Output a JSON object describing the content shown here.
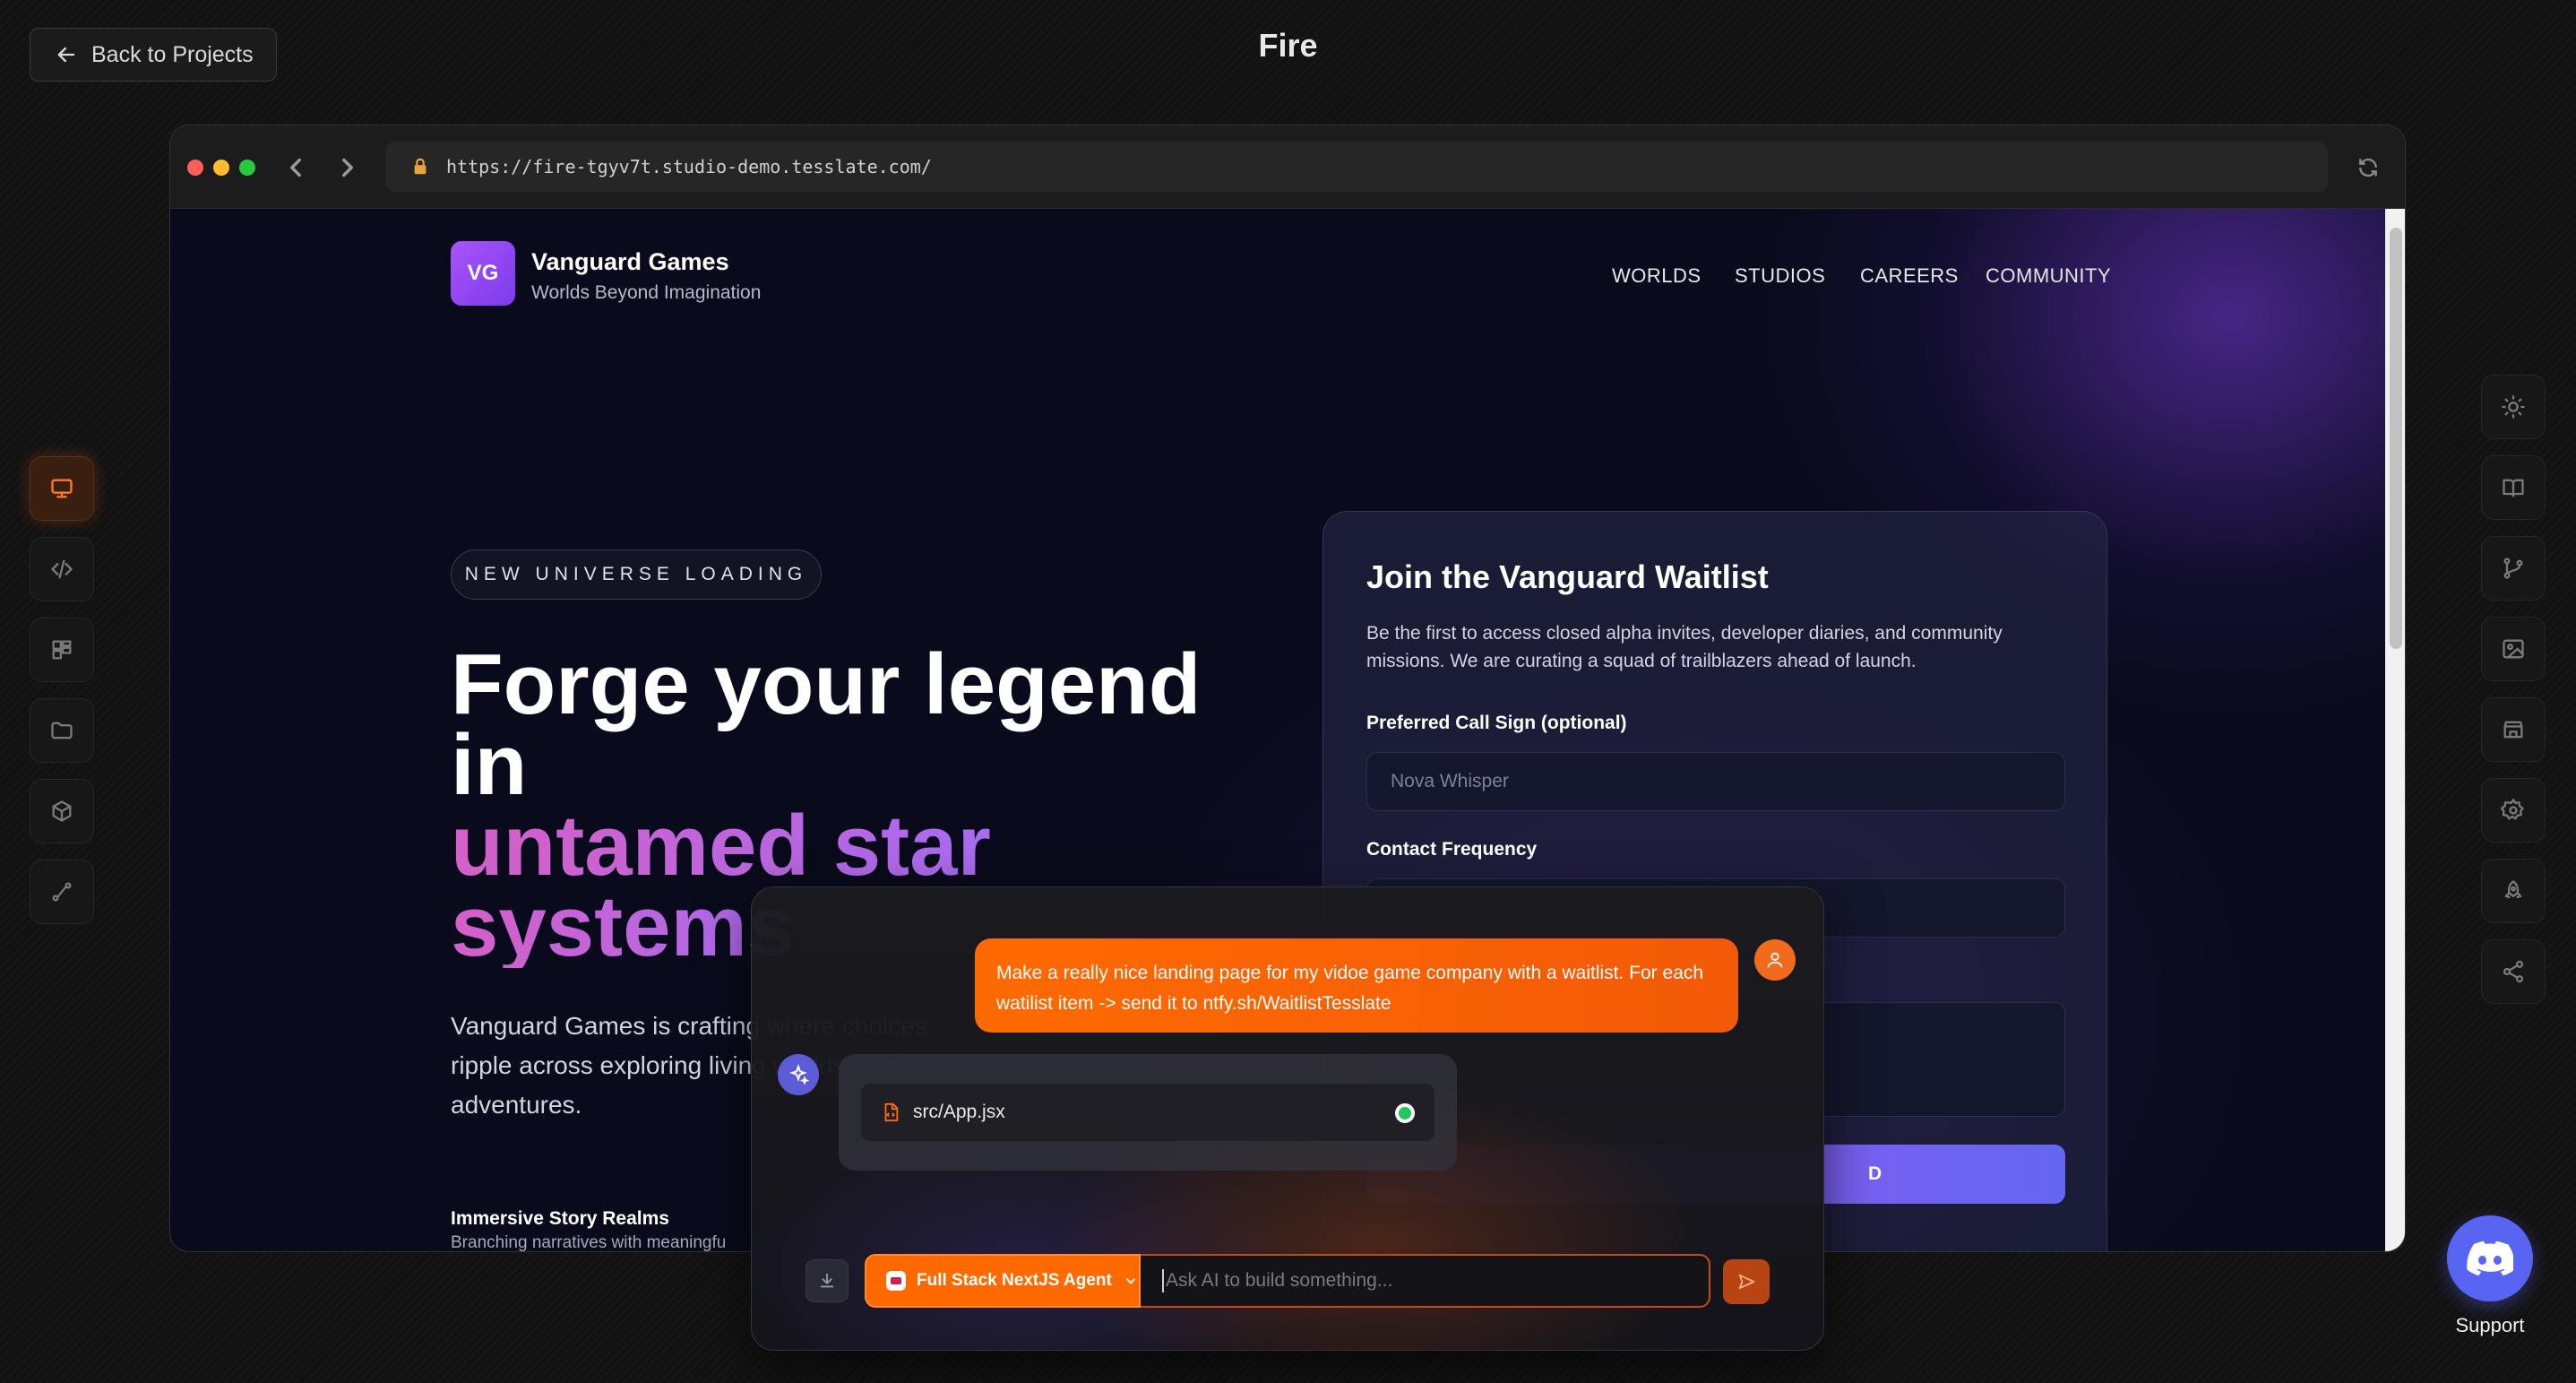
{
  "app": {
    "title": "Fire",
    "back_label": "Back to Projects"
  },
  "left_rail": [
    {
      "name": "preview",
      "icon": "monitor-icon",
      "active": true
    },
    {
      "name": "code",
      "icon": "code-icon",
      "active": false
    },
    {
      "name": "kanban",
      "icon": "kanban-icon",
      "active": false
    },
    {
      "name": "files",
      "icon": "folder-icon",
      "active": false
    },
    {
      "name": "assets",
      "icon": "box-icon",
      "active": false
    },
    {
      "name": "flow",
      "icon": "route-icon",
      "active": false
    }
  ],
  "right_rail": [
    {
      "name": "theme",
      "icon": "sun-icon"
    },
    {
      "name": "docs",
      "icon": "book-icon"
    },
    {
      "name": "git",
      "icon": "git-branch-icon"
    },
    {
      "name": "images",
      "icon": "image-icon"
    },
    {
      "name": "marketplace",
      "icon": "store-icon"
    },
    {
      "name": "settings",
      "icon": "gear-icon"
    },
    {
      "name": "deploy",
      "icon": "rocket-icon"
    },
    {
      "name": "share",
      "icon": "share-icon"
    }
  ],
  "browser": {
    "url": "https://fire-tgyv7t.studio-demo.tesslate.com/"
  },
  "site": {
    "logo_initials": "VG",
    "brand_name": "Vanguard Games",
    "brand_tagline": "Worlds Beyond Imagination",
    "nav": [
      "WORLDS",
      "STUDIOS",
      "CAREERS",
      "COMMUNITY"
    ],
    "pill": "NEW UNIVERSE LOADING",
    "hero_line1": "Forge your legend",
    "hero_line2": "in",
    "hero_line3": "untamed star",
    "hero_line4": "systems",
    "hero_paragraph": "Vanguard Games is crafting where choices ripple across exploring living worlds, evol adventures.",
    "feature_title": "Immersive Story Realms",
    "feature_sub": "Branching narratives with meaningfu"
  },
  "waitlist": {
    "title": "Join the Vanguard Waitlist",
    "description": "Be the first to access closed alpha invites, developer diaries, and community missions. We are curating a squad of trailblazers ahead of launch.",
    "callsign_label": "Preferred Call Sign (optional)",
    "callsign_placeholder": "Nova Whisper",
    "frequency_label": "Contact Frequency",
    "cta_partial": "D"
  },
  "chat": {
    "user_message": "Make a really nice landing page for my vidoe game company with a waitlist. For each watilist item -> send it to ntfy.sh/WaitlistTesslate",
    "file_name": "src/App.jsx",
    "agent_label": "Full Stack NextJS Agent",
    "input_placeholder": "Ask AI to build something..."
  },
  "support": {
    "label": "Support"
  },
  "colors": {
    "accent": "#ff6a00",
    "brand_purple": "#a855f7",
    "discord": "#5865f2"
  }
}
